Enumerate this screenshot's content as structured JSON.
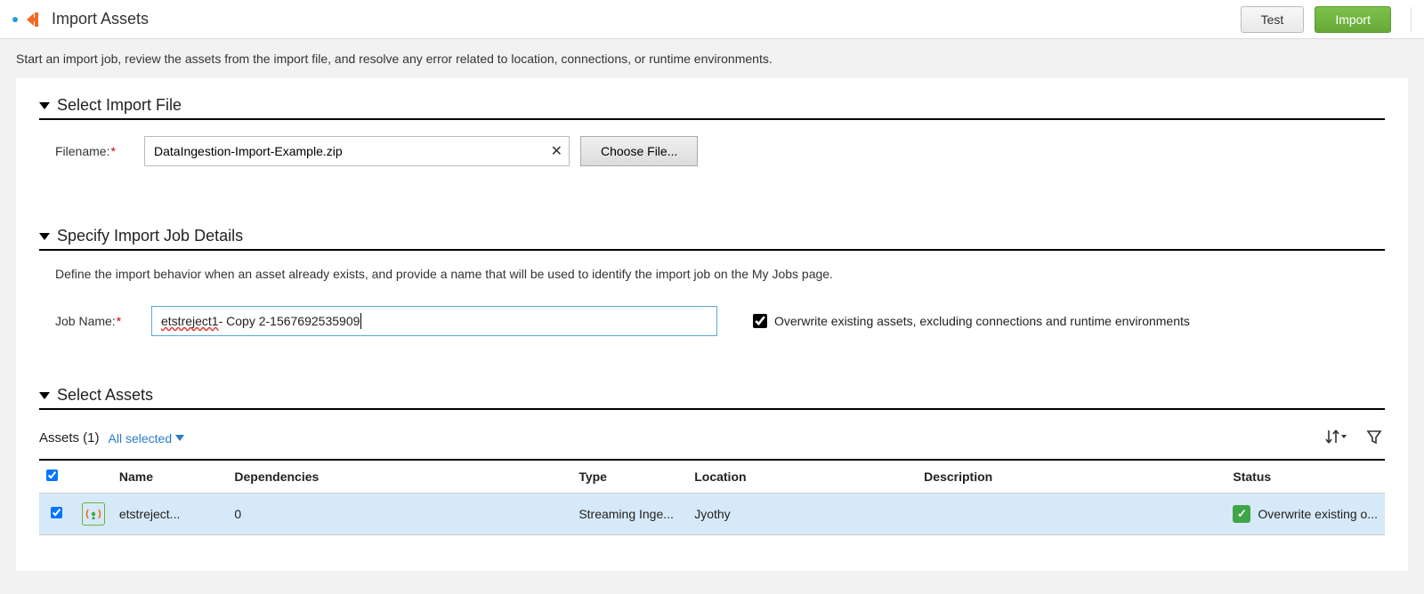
{
  "header": {
    "title": "Import Assets",
    "test_label": "Test",
    "import_label": "Import"
  },
  "description": "Start an import job, review the assets from the import file, and resolve any error related to location, connections, or runtime environments.",
  "select_file": {
    "title": "Select Import File",
    "filename_label": "Filename:",
    "filename_value": "DataIngestion-Import-Example.zip",
    "choose_label": "Choose File..."
  },
  "job_details": {
    "title": "Specify Import Job Details",
    "subdesc": "Define the import behavior when an asset already exists, and provide a name that will be used to identify the import job on the My Jobs page.",
    "job_name_label": "Job Name:",
    "job_name_prefix": "etstreject1",
    "job_name_suffix": " - Copy 2-1567692535909",
    "overwrite_label": "Overwrite existing assets, excluding connections and runtime environments",
    "overwrite_checked": true
  },
  "select_assets": {
    "title": "Select Assets",
    "count_label": "Assets (1)",
    "all_selected_label": "All selected",
    "columns": {
      "name": "Name",
      "dependencies": "Dependencies",
      "type": "Type",
      "location": "Location",
      "description": "Description",
      "status": "Status"
    },
    "rows": [
      {
        "name": "etstreject...",
        "dependencies": "0",
        "type": "Streaming Inge...",
        "location": "Jyothy",
        "description": "",
        "status": "Overwrite existing o..."
      }
    ]
  }
}
